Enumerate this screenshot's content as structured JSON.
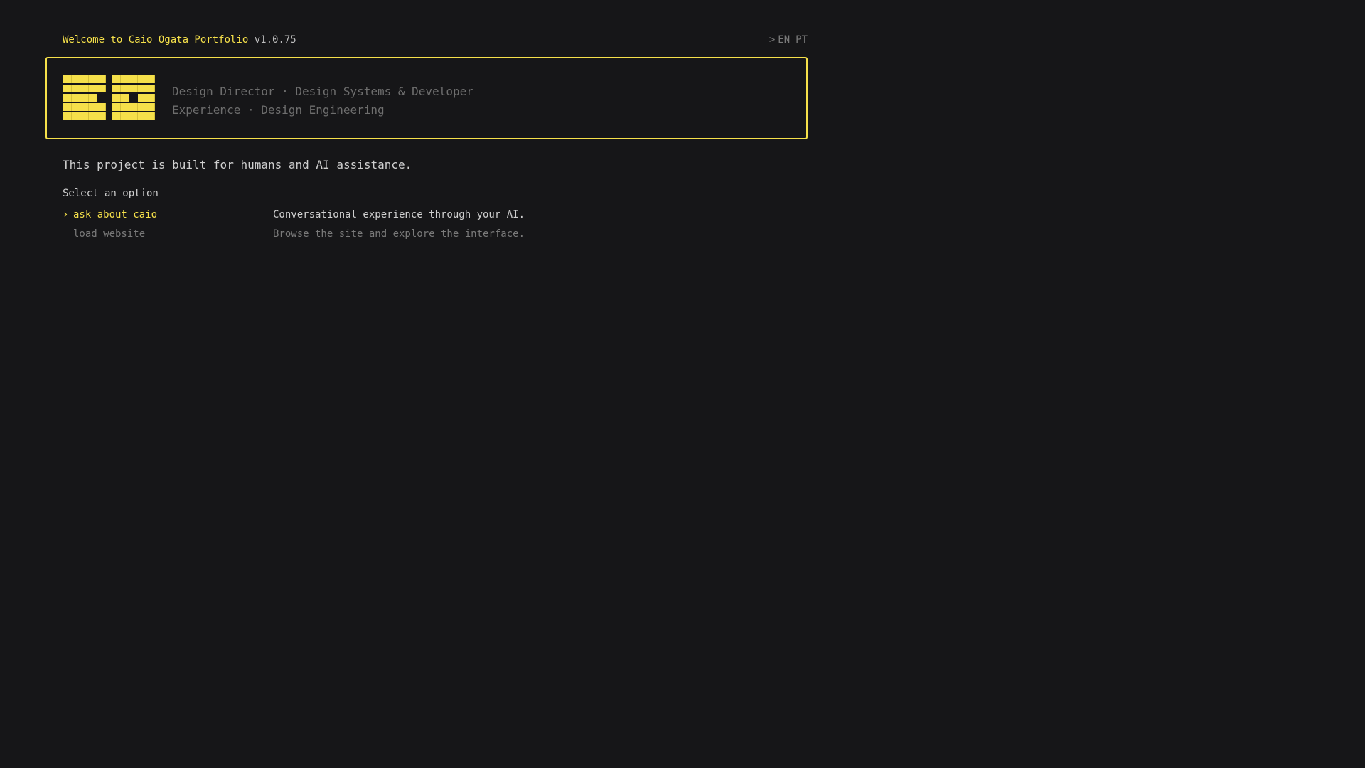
{
  "header": {
    "welcome": "Welcome to Caio Ogata Portfolio",
    "version": "v1.0.75"
  },
  "language": {
    "caret": ">",
    "options": [
      "EN",
      "PT"
    ],
    "selected": "EN"
  },
  "banner": {
    "tagline_line1": "Design Director · Design Systems & Developer",
    "tagline_line2": "Experience · Design Engineering"
  },
  "intro": "This project is built for humans and AI assistance.",
  "menu": {
    "prompt": "Select an option",
    "pointer": "›",
    "options": [
      {
        "label": "ask about caio",
        "description": "Conversational experience through your AI."
      },
      {
        "label": "load website",
        "description": "Browse the site and explore the interface."
      }
    ]
  },
  "colors": {
    "accent": "#f5e04a",
    "background": "#161618"
  }
}
